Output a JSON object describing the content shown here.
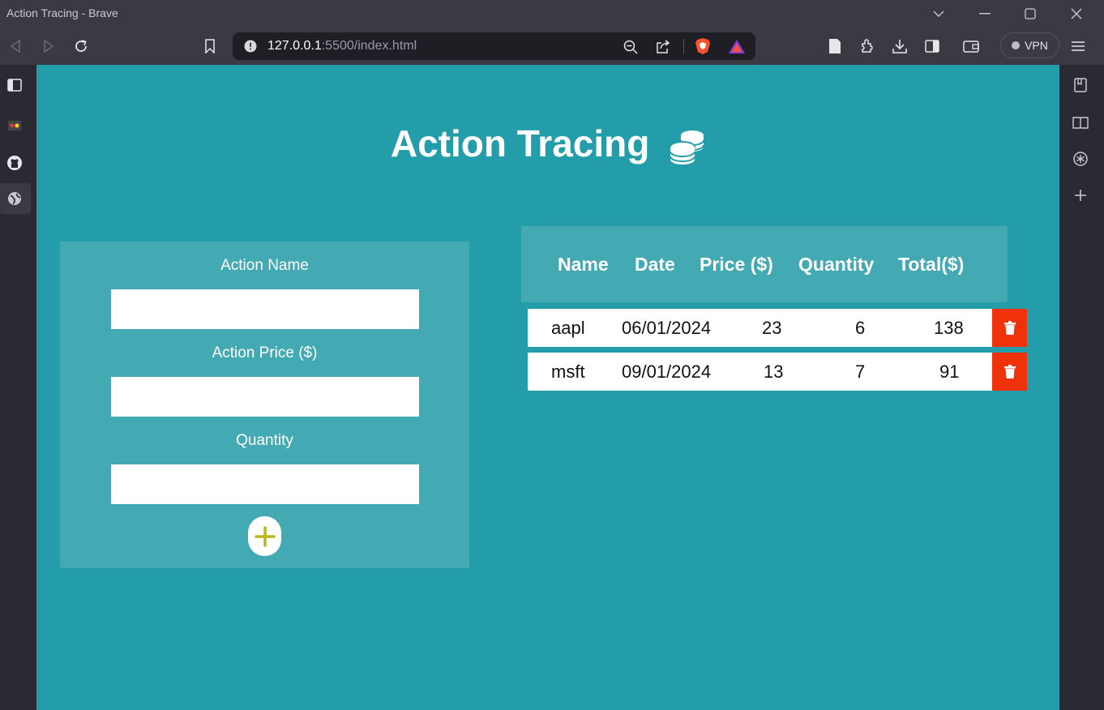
{
  "window": {
    "title": "Action Tracing - Brave"
  },
  "toolbar": {
    "url_host": "127.0.0.1",
    "url_rest": ":5500/index.html",
    "vpn_label": "VPN"
  },
  "page": {
    "heading": "Action Tracing",
    "form": {
      "name_label": "Action Name",
      "name_value": "",
      "price_label": "Action Price ($)",
      "price_value": "",
      "quantity_label": "Quantity",
      "quantity_value": ""
    },
    "table": {
      "headers": [
        "Name",
        "Date",
        "Price ($)",
        "Quantity",
        "Total($)"
      ],
      "rows": [
        {
          "name": "aapl",
          "date": "06/01/2024",
          "price": "23",
          "quantity": "6",
          "total": "138"
        },
        {
          "name": "msft",
          "date": "09/01/2024",
          "price": "13",
          "quantity": "7",
          "total": "91"
        }
      ]
    }
  },
  "colors": {
    "page_bg": "#239daa",
    "card_bg": "#43a9b3",
    "delete_bg": "#f0320b",
    "add_icon": "#b8b81a"
  },
  "icons": {
    "back": "back-arrow-icon",
    "forward": "forward-arrow-icon",
    "reload": "reload-icon",
    "bookmark": "bookmark-icon",
    "coins": "coins-icon",
    "add": "plus-icon",
    "delete": "trash-icon"
  }
}
